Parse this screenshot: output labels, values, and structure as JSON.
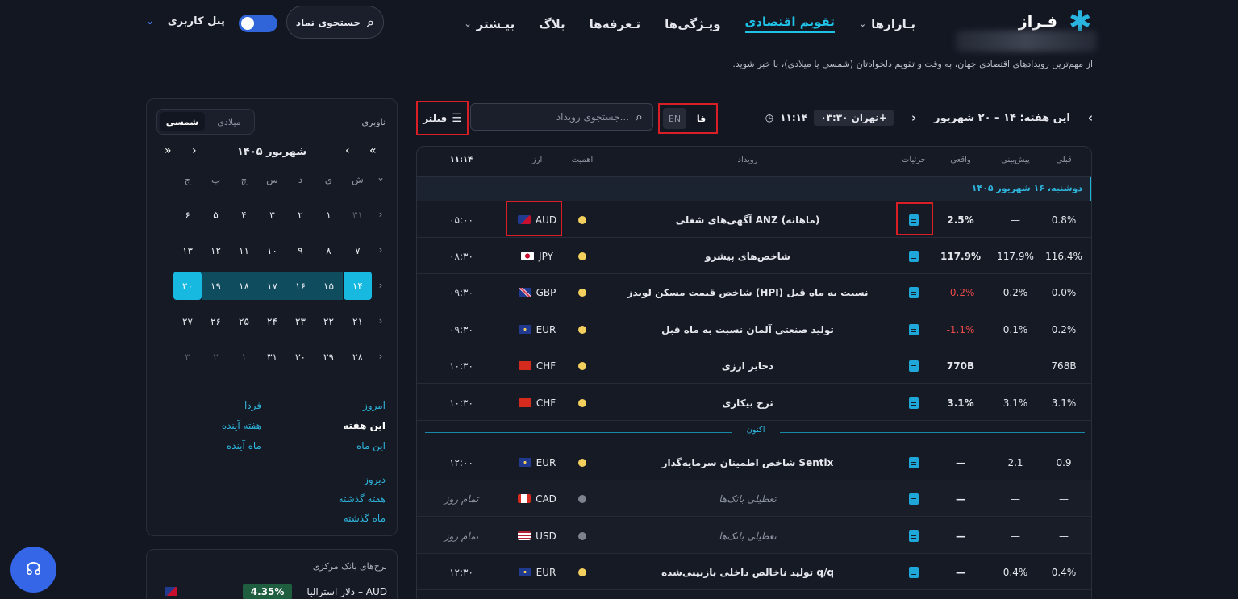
{
  "header": {
    "logo_text": "فـراز",
    "nav": [
      {
        "label": "بـازارها",
        "chevron": true,
        "active": false
      },
      {
        "label": "تقویم اقتصادی",
        "chevron": false,
        "active": true
      },
      {
        "label": "ویـژگی‌ها",
        "chevron": false,
        "active": false
      },
      {
        "label": "تـعرفه‌ها",
        "chevron": false,
        "active": false
      },
      {
        "label": "بلاگ",
        "chevron": false,
        "active": false
      },
      {
        "label": "بیـشتر",
        "chevron": true,
        "active": false
      }
    ],
    "symbol_search": "جستجوی نماد",
    "user_panel": "پنل کاربری"
  },
  "subtitle": "از مهم‌ترین رویدادهای اقتصادی جهان، به وقت و تقویم دلخواه‌تان (شمسی یا میلادی)، با خبر شوید.",
  "sidebar": {
    "navigator_label": "ناوبری",
    "calendar_options": [
      "شمسی",
      "میلادی"
    ],
    "month_label": "شهریور ۱۴۰۵",
    "weekdays": [
      "ش",
      "ی",
      "د",
      "س",
      "چ",
      "پ",
      "ج"
    ],
    "weeks": [
      [
        "۳۱",
        "۱",
        "۲",
        "۳",
        "۴",
        "۵",
        "۶"
      ],
      [
        "۷",
        "۸",
        "۹",
        "۱۰",
        "۱۱",
        "۱۲",
        "۱۳"
      ],
      [
        "۱۴",
        "۱۵",
        "۱۶",
        "۱۷",
        "۱۸",
        "۱۹",
        "۲۰"
      ],
      [
        "۲۱",
        "۲۲",
        "۲۳",
        "۲۴",
        "۲۵",
        "۲۶",
        "۲۷"
      ],
      [
        "۲۸",
        "۲۹",
        "۳۰",
        "۳۱",
        "۱",
        "۲",
        "۳"
      ]
    ],
    "quick_links": {
      "today": "امروز",
      "tomorrow": "فردا",
      "this_week": "این هفته",
      "next_week": "هفته آینده",
      "this_month": "این ماه",
      "next_month": "ماه آینده",
      "yesterday": "دیروز",
      "last_week": "هفته گذشته",
      "last_month": "ماه گذشته"
    }
  },
  "rates": {
    "title": "نرخ‌های بانک مرکزی",
    "rows": [
      {
        "name": "دلار استرالیا – AUD",
        "value": "4.35%"
      }
    ]
  },
  "toolbar": {
    "week_label": "این هفته: ۱۴ – ۲۰ شهریور",
    "timezone": "تهران ۰۳:۳۰+",
    "clock": "۱۱:۱۴",
    "lang_en": "EN",
    "lang_fa": "فا",
    "event_search_placeholder": "جستجوی رویداد...",
    "filter_label": "فیلتر"
  },
  "table": {
    "headers": {
      "prev": "قبلی",
      "forecast": "پیش‌بینی",
      "actual": "واقعی",
      "details": "جزئیات",
      "event": "رویداد",
      "importance": "اهمیت",
      "currency": "ارز",
      "time": "۱۱:۱۴"
    },
    "date_label": "دوشنبه، ۱۶ شهریور ۱۴۰۵",
    "now_label": "اکنون",
    "rows": [
      {
        "prev": "0.8%",
        "forecast": "—",
        "actual": "2.5%",
        "event": "آگهی‌های شغلی ANZ (ماهانه)",
        "currency": "AUD",
        "time": "۰۵:۰۰",
        "holiday": false
      },
      {
        "prev": "116.4%",
        "forecast": "117.9%",
        "actual": "117.9%",
        "event": "شاخص‌های پیشرو",
        "currency": "JPY",
        "time": "۰۸:۳۰",
        "holiday": false
      },
      {
        "prev": "0.0%",
        "forecast": "0.2%",
        "actual": "-0.2%",
        "event": "شاخص قیمت مسکن لویدز (HPI) نسبت به ماه قبل",
        "currency": "GBP",
        "time": "۰۹:۳۰",
        "holiday": false
      },
      {
        "prev": "0.2%",
        "forecast": "0.1%",
        "actual": "-1.1%",
        "event": "تولید صنعتی آلمان نسبت به ماه قبل",
        "currency": "EUR",
        "time": "۰۹:۳۰",
        "holiday": false
      },
      {
        "prev": "768B",
        "forecast": "",
        "actual": "770B",
        "event": "ذخایر ارزی",
        "currency": "CHF",
        "time": "۱۰:۳۰",
        "holiday": false
      },
      {
        "prev": "3.1%",
        "forecast": "3.1%",
        "actual": "3.1%",
        "event": "نرخ بیکاری",
        "currency": "CHF",
        "time": "۱۰:۳۰",
        "holiday": false
      },
      {
        "prev": "0.9",
        "forecast": "2.1",
        "actual": "—",
        "event": "شاخص اطمینان سرمایه‌گذار Sentix",
        "currency": "EUR",
        "time": "۱۲:۰۰",
        "holiday": false
      },
      {
        "prev": "—",
        "forecast": "—",
        "actual": "—",
        "event": "تعطیلی بانک‌ها",
        "currency": "CAD",
        "time": "تمام روز",
        "holiday": true
      },
      {
        "prev": "—",
        "forecast": "—",
        "actual": "—",
        "event": "تعطیلی بانک‌ها",
        "currency": "USD",
        "time": "تمام روز",
        "holiday": true
      },
      {
        "prev": "0.4%",
        "forecast": "0.4%",
        "actual": "—",
        "event": "تولید ناخالص داخلی بازبینی‌شده q/q",
        "currency": "EUR",
        "time": "۱۲:۳۰",
        "holiday": false
      }
    ]
  },
  "colors": {
    "accent": "#1bb6de",
    "negative": "#ef4b4b",
    "highlight_box": "#d91f26"
  }
}
